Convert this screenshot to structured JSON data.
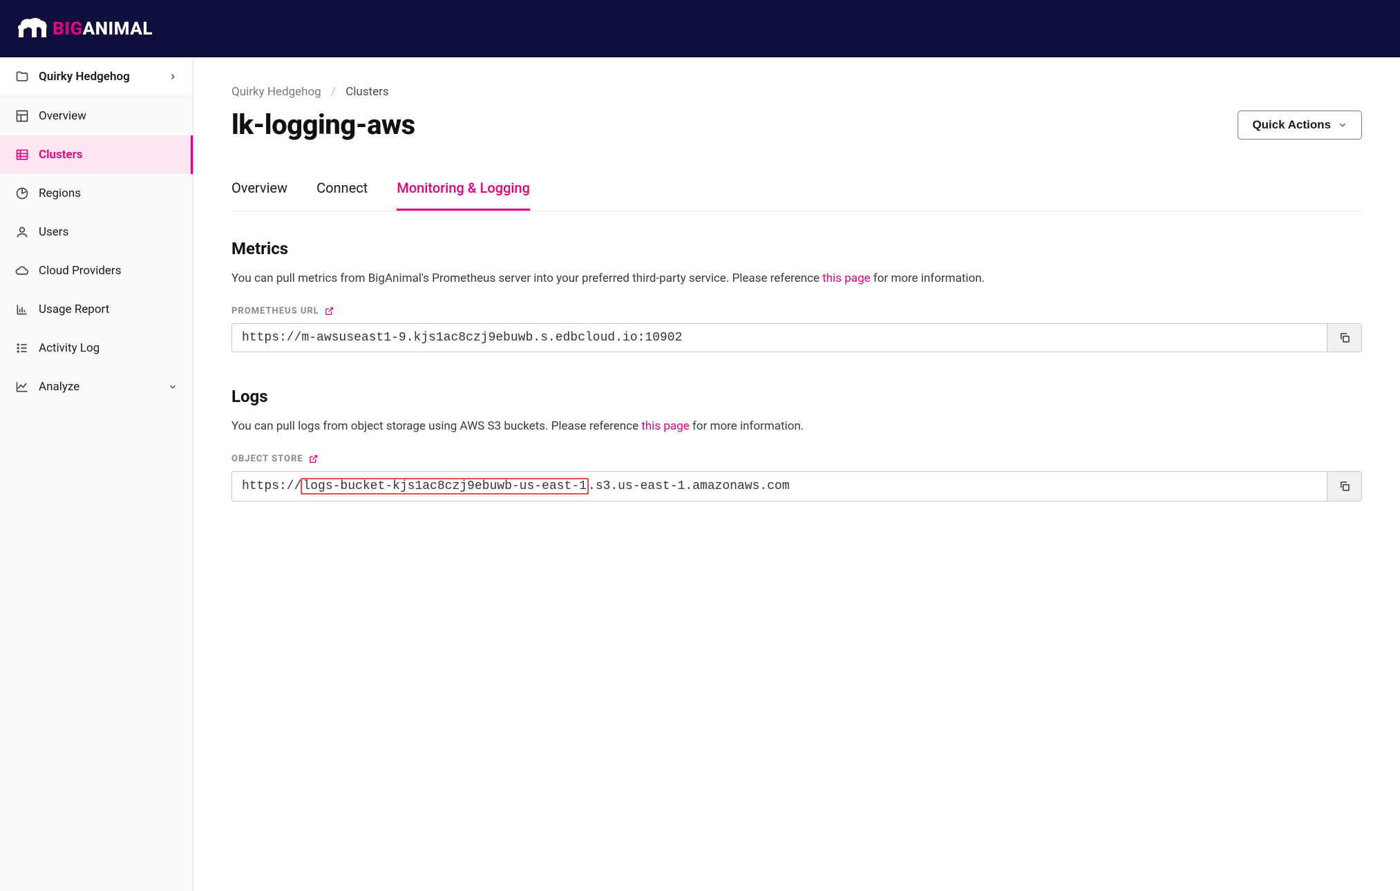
{
  "brand": {
    "big": "BIG",
    "animal": "ANIMAL"
  },
  "sidebar": {
    "project": "Quirky Hedgehog",
    "items": [
      {
        "label": "Overview"
      },
      {
        "label": "Clusters"
      },
      {
        "label": "Regions"
      },
      {
        "label": "Users"
      },
      {
        "label": "Cloud Providers"
      },
      {
        "label": "Usage Report"
      },
      {
        "label": "Activity Log"
      },
      {
        "label": "Analyze"
      }
    ]
  },
  "breadcrumb": {
    "project": "Quirky Hedgehog",
    "section": "Clusters"
  },
  "page_title": "lk-logging-aws",
  "quick_actions": "Quick Actions",
  "tabs": [
    {
      "label": "Overview"
    },
    {
      "label": "Connect"
    },
    {
      "label": "Monitoring & Logging"
    }
  ],
  "metrics": {
    "heading": "Metrics",
    "desc_pre": "You can pull metrics from BigAnimal's Prometheus server into your preferred third-party service. Please reference ",
    "link": "this page",
    "desc_post": " for more information.",
    "label": "PROMETHEUS URL",
    "url": "https://m-awsuseast1-9.kjs1ac8czj9ebuwb.s.edbcloud.io:10902"
  },
  "logs": {
    "heading": "Logs",
    "desc_pre": "You can pull logs from object storage using AWS S3 buckets. Please reference ",
    "link": "this page",
    "desc_post": " for more information.",
    "label": "OBJECT STORE",
    "url_pre": "https://",
    "url_hl": "logs-bucket-kjs1ac8czj9ebuwb-us-east-1",
    "url_post": ".s3.us-east-1.amazonaws.com"
  }
}
